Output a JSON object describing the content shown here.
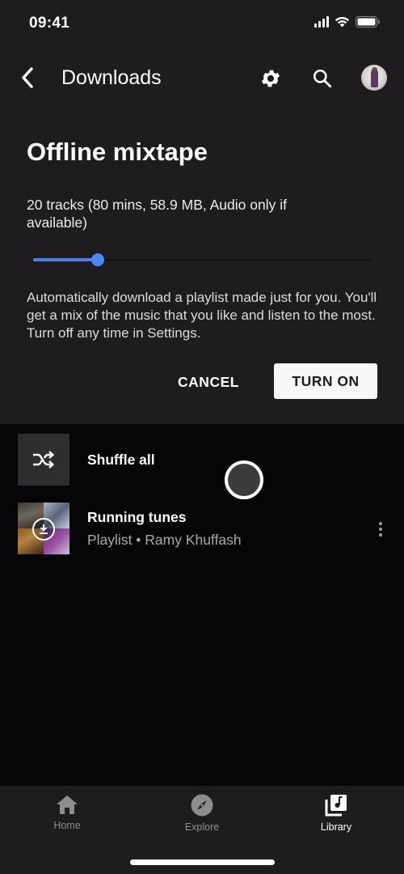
{
  "status_bar": {
    "time": "09:41",
    "icons": [
      "cellular-signal-icon",
      "wifi-icon",
      "battery-icon"
    ]
  },
  "app_bar": {
    "title": "Downloads",
    "back_icon": "chevron-left-icon",
    "settings_icon": "gear-icon",
    "search_icon": "search-icon",
    "avatar_icon": "user-avatar"
  },
  "offline_mixtape": {
    "title": "Offline mixtape",
    "info": "20 tracks (80 mins, 58.9 MB, Audio only if available)",
    "slider": {
      "value_fraction": 0.19,
      "color": "#4f86f7"
    },
    "description": "Automatically download a playlist made just for you. You'll get a mix of the music that you like and listen to the most. Turn off any time in Settings.",
    "cancel_label": "CANCEL",
    "turn_on_label": "TURN ON"
  },
  "list": {
    "items": [
      {
        "title": "Shuffle all",
        "icon": "shuffle-icon"
      },
      {
        "title": "Running tunes",
        "subtitle": "Playlist • Ramy Khuffash",
        "badge_icon": "download-done-icon",
        "menu_icon": "more-vert-icon"
      }
    ]
  },
  "bottom_nav": {
    "items": [
      {
        "label": "Home",
        "icon": "home-icon",
        "active": false
      },
      {
        "label": "Explore",
        "icon": "compass-icon",
        "active": false
      },
      {
        "label": "Library",
        "icon": "library-music-icon",
        "active": true
      }
    ]
  }
}
